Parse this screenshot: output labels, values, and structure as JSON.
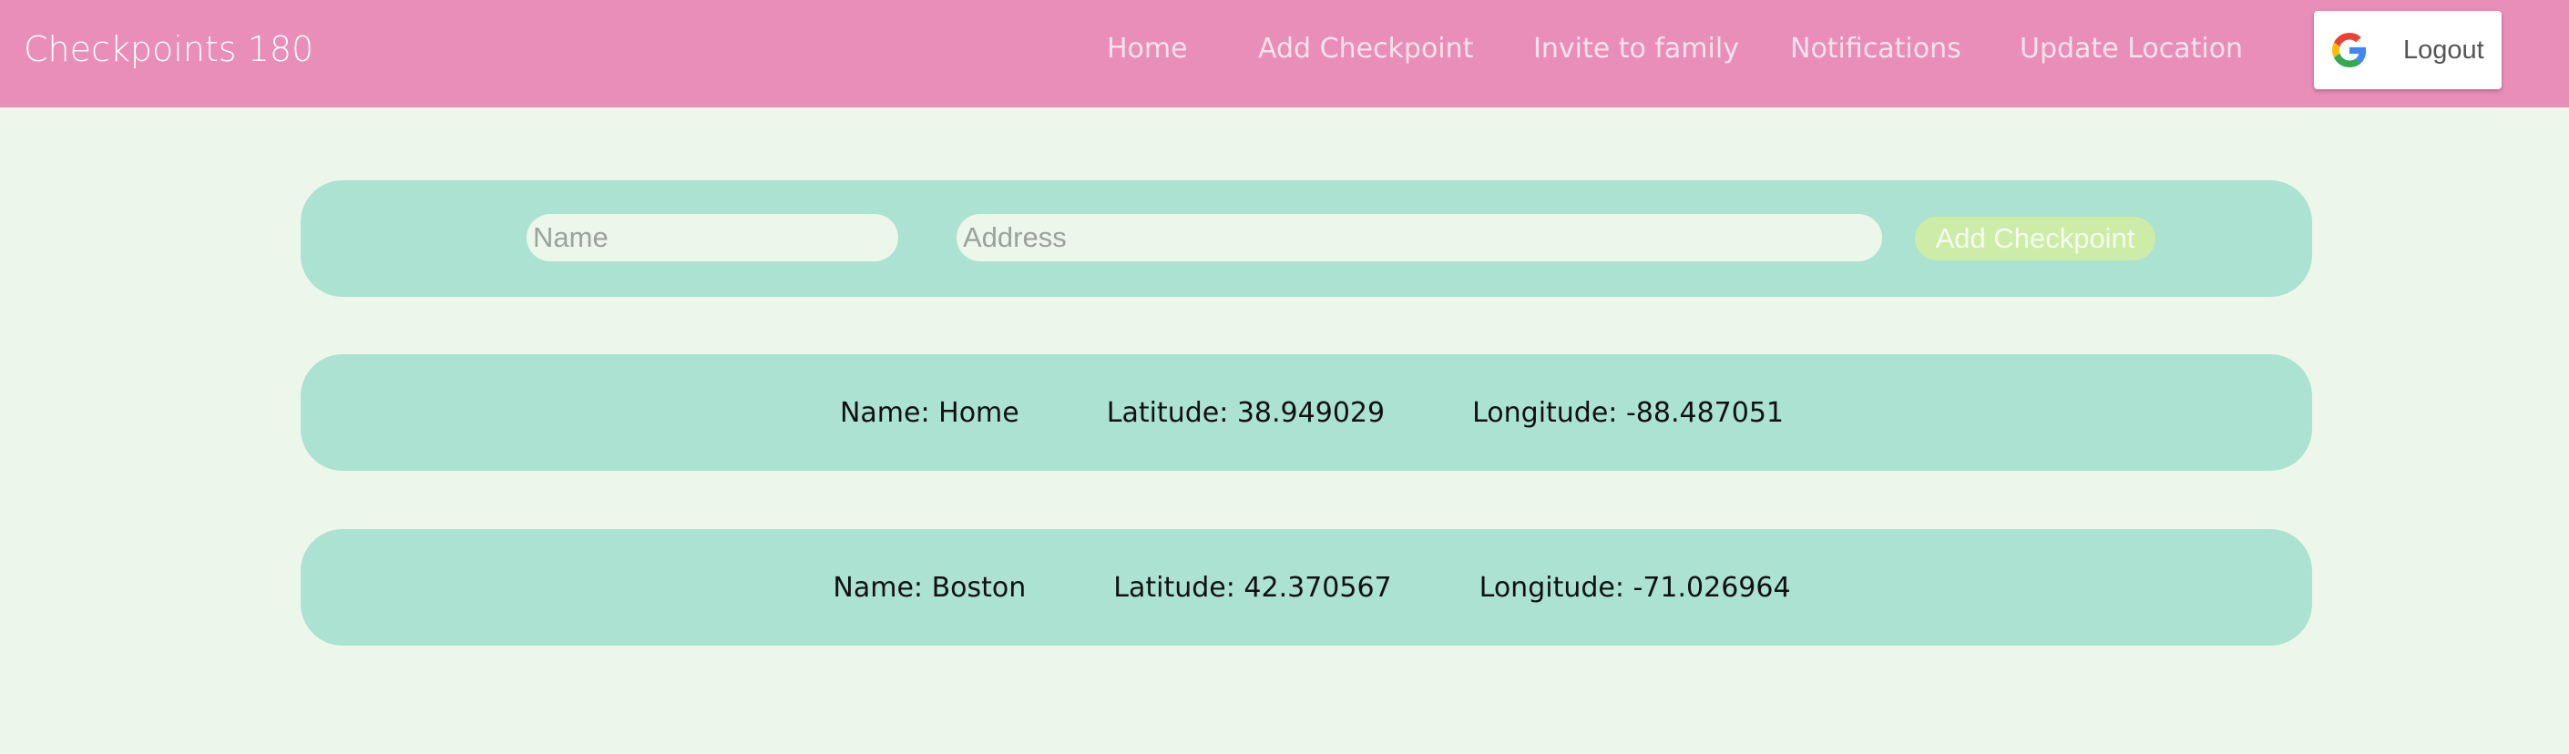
{
  "navbar": {
    "brand": "Checkpoints 180",
    "links": [
      {
        "label": "Home"
      },
      {
        "label": "Add Checkpoint"
      },
      {
        "label": "Invite to family"
      },
      {
        "label": "Notifications"
      },
      {
        "label": "Update Location"
      }
    ],
    "logout_label": "Logout",
    "color": "#e98db9"
  },
  "form": {
    "name_placeholder": "Name",
    "address_placeholder": "Address",
    "add_button_label": "Add Checkpoint"
  },
  "checkpoints": [
    {
      "name": "Name: Home",
      "latitude": "Latitude: 38.949029",
      "longitude": "Longitude: -88.487051"
    },
    {
      "name": "Name: Boston",
      "latitude": "Latitude: 42.370567",
      "longitude": "Longitude: -71.026964"
    }
  ],
  "colors": {
    "background": "#edf6ea",
    "card": "#ace2d1",
    "button": "#cdeca8"
  },
  "icons": {
    "logout": "google-g-icon"
  }
}
